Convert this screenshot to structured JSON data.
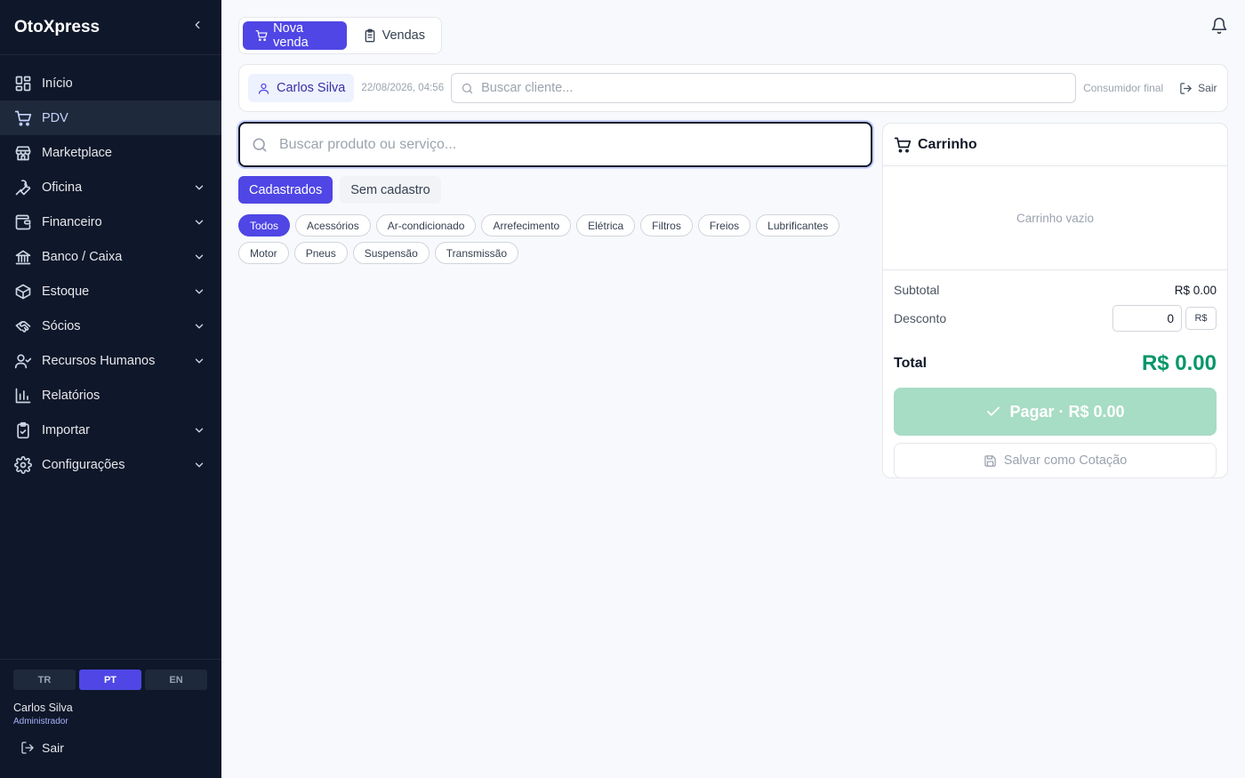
{
  "app": {
    "title": "OtoXpress"
  },
  "sidebar": {
    "items": [
      {
        "label": "Início",
        "icon": "dashboard-icon",
        "active": false,
        "expandable": false
      },
      {
        "label": "PDV",
        "icon": "cart-icon",
        "active": true,
        "expandable": false
      },
      {
        "label": "Marketplace",
        "icon": "store-icon",
        "active": false,
        "expandable": false
      },
      {
        "label": "Oficina",
        "icon": "wrench-icon",
        "active": false,
        "expandable": true
      },
      {
        "label": "Financeiro",
        "icon": "wallet-icon",
        "active": false,
        "expandable": true
      },
      {
        "label": "Banco / Caixa",
        "icon": "bank-icon",
        "active": false,
        "expandable": true
      },
      {
        "label": "Estoque",
        "icon": "box-icon",
        "active": false,
        "expandable": true
      },
      {
        "label": "Sócios",
        "icon": "handshake-icon",
        "active": false,
        "expandable": true
      },
      {
        "label": "Recursos Humanos",
        "icon": "user-check-icon",
        "active": false,
        "expandable": true
      },
      {
        "label": "Relatórios",
        "icon": "bar-chart-icon",
        "active": false,
        "expandable": false
      },
      {
        "label": "Importar",
        "icon": "clipboard-check-icon",
        "active": false,
        "expandable": true
      },
      {
        "label": "Configurações",
        "icon": "gear-icon",
        "active": false,
        "expandable": true
      }
    ],
    "languages": [
      {
        "code": "TR",
        "active": false
      },
      {
        "code": "PT",
        "active": true
      },
      {
        "code": "EN",
        "active": false
      }
    ],
    "user": {
      "name": "Carlos Silva",
      "role": "Administrador"
    },
    "logout_label": "Sair"
  },
  "header": {
    "tabs": [
      {
        "label": "Nova venda",
        "icon": "cart-icon",
        "active": true
      },
      {
        "label": "Vendas",
        "icon": "clipboard-icon",
        "active": false
      }
    ]
  },
  "customer_bar": {
    "operator": "Carlos Silva",
    "datetime": "22/08/2026, 04:56",
    "search_placeholder": "Buscar cliente...",
    "final_consumer_label": "Consumidor final",
    "logout_label": "Sair"
  },
  "product_search": {
    "placeholder": "Buscar produto ou serviço..."
  },
  "source_tabs": [
    {
      "label": "Cadastrados",
      "active": true
    },
    {
      "label": "Sem cadastro",
      "active": false
    }
  ],
  "categories": [
    {
      "label": "Todos",
      "active": true
    },
    {
      "label": "Acessórios",
      "active": false
    },
    {
      "label": "Ar-condicionado",
      "active": false
    },
    {
      "label": "Arrefecimento",
      "active": false
    },
    {
      "label": "Elétrica",
      "active": false
    },
    {
      "label": "Filtros",
      "active": false
    },
    {
      "label": "Freios",
      "active": false
    },
    {
      "label": "Lubrificantes",
      "active": false
    },
    {
      "label": "Motor",
      "active": false
    },
    {
      "label": "Pneus",
      "active": false
    },
    {
      "label": "Suspensão",
      "active": false
    },
    {
      "label": "Transmissão",
      "active": false
    }
  ],
  "cart": {
    "title": "Carrinho",
    "empty_text": "Carrinho vazio",
    "subtotal_label": "Subtotal",
    "subtotal_value": "R$ 0.00",
    "discount_label": "Desconto",
    "discount_value": "0",
    "discount_unit": "R$",
    "total_label": "Total",
    "total_value": "R$ 0.00",
    "pay_label": "Pagar · R$ 0.00",
    "save_quote_label": "Salvar como Cotação"
  },
  "colors": {
    "sidebar_bg": "#0f172a",
    "accent": "#4f46e5",
    "total_green": "#059669",
    "pay_disabled": "#a7dcc5"
  }
}
